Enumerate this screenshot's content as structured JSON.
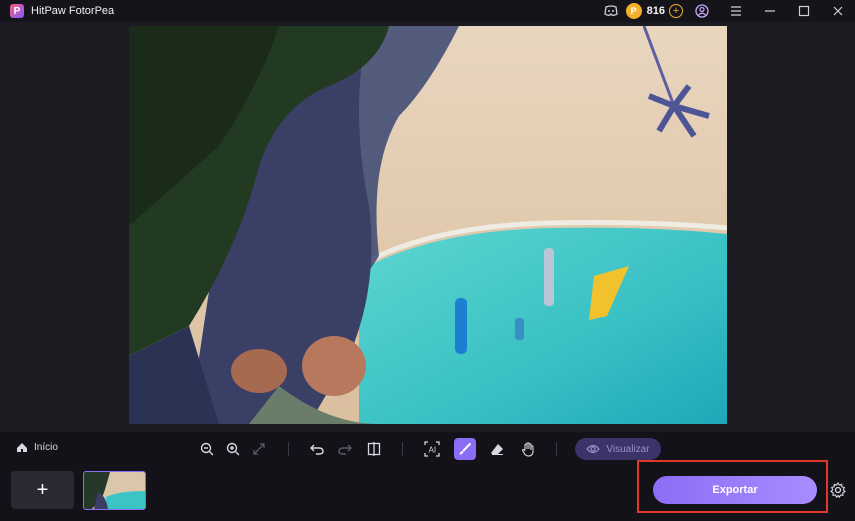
{
  "app": {
    "title": "HitPaw FotorPea",
    "logo_letter": "P"
  },
  "titlebar": {
    "credits": "816",
    "coin_symbol": "P"
  },
  "toolbar": {
    "home_label": "Início",
    "preview_label": "Visualizar"
  },
  "bottom": {
    "add_label": "+",
    "export_label": "Exportar"
  },
  "colors": {
    "accent": "#8b6cf7",
    "highlight_border": "#e0392b",
    "coin": "#f4b02a"
  },
  "icons": [
    "discord-icon",
    "coin-icon",
    "add-credits-icon",
    "account-icon",
    "menu-icon",
    "minimize-icon",
    "maximize-icon",
    "close-icon",
    "home-icon",
    "zoom-out-icon",
    "zoom-in-icon",
    "fit-screen-icon",
    "undo-icon",
    "redo-icon",
    "compare-icon",
    "ai-select-icon",
    "brush-icon",
    "eraser-icon",
    "hand-icon",
    "eye-icon",
    "settings-icon"
  ]
}
